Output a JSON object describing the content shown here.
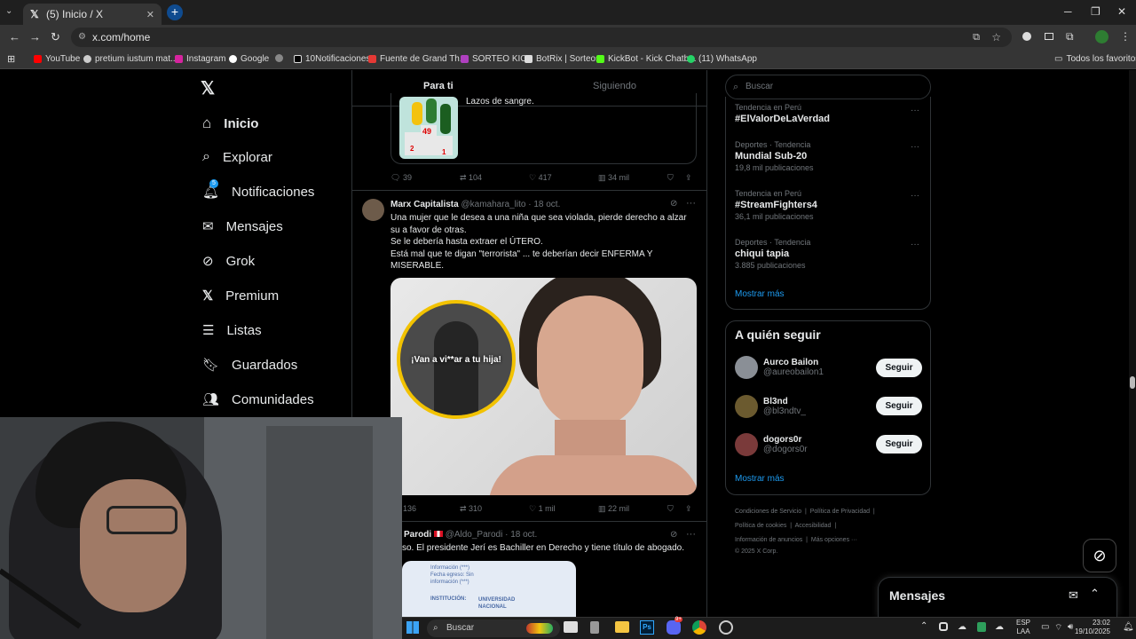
{
  "browser": {
    "tab_title": "(5) Inicio / X",
    "url": "x.com/home",
    "bookmarks": [
      "YouTube",
      "pretium iustum mat...",
      "Instagram",
      "Google",
      "10Notificaciones",
      "Fuente de Grand Th...",
      "SORTEO KICK",
      "BotRix | Sorteos",
      "KickBot - Kick Chatb...",
      "(11) WhatsApp"
    ],
    "bookmarks_right": "Todos los favoritos"
  },
  "nav": {
    "items": [
      "Inicio",
      "Explorar",
      "Notificaciones",
      "Mensajes",
      "Grok",
      "Premium",
      "Listas",
      "Guardados",
      "Comunidades"
    ],
    "notif_badge": "5"
  },
  "feed": {
    "tabs": [
      "Para ti",
      "Siguiendo"
    ],
    "prev_tweet": {
      "text": "Lazos de sangre.",
      "img_nums": [
        "49",
        "2",
        "1"
      ],
      "replies": "39",
      "retweets": "104",
      "likes": "417",
      "views": "34 mil"
    },
    "tweet1": {
      "name": "Marx Capitalista",
      "handle": "@kamahara_lito",
      "date": "· 18 oct.",
      "lines": [
        "Una mujer que le desea a una niña que sea violada, pierde derecho a alzar",
        "su a favor de otras.",
        "Se le debería hasta extraer el ÚTERO.",
        "Está mal que te digan \"terrorista\" ... te deberían decir ENFERMA Y",
        "MISERABLE."
      ],
      "overlay_text": "¡Van a vi**ar a tu hija!",
      "replies": "136",
      "retweets": "310",
      "likes": "1 mil",
      "views": "22 mil"
    },
    "tweet2": {
      "name": "do Parodi",
      "handle": "@Aldo_Parodi",
      "date": "· 18 oct.",
      "text": "so. El presidente Jerí es Bachiller en Derecho y tiene título de abogado.",
      "doc_lines": [
        "Información (***)",
        "Fecha egreso: Sin",
        "información (***)"
      ],
      "doc_label": "INSTITUCIÓN:",
      "doc_value": "UNIVERSIDAD NACIONAL"
    }
  },
  "sidebar": {
    "search_placeholder": "Buscar",
    "trends": [
      {
        "cat": "Tendencia en Perú",
        "name": "#ElValorDeLaVerdad",
        "count": ""
      },
      {
        "cat": "Deportes · Tendencia",
        "name": "Mundial Sub-20",
        "count": "19,8 mil publicaciones"
      },
      {
        "cat": "Tendencia en Perú",
        "name": "#StreamFighters4",
        "count": "36,1 mil publicaciones"
      },
      {
        "cat": "Deportes · Tendencia",
        "name": "chiqui tapia",
        "count": "3.885 publicaciones"
      }
    ],
    "show_more": "Mostrar más",
    "who_to_follow": "A quién seguir",
    "follows": [
      {
        "name": "Aurco Bailon",
        "handle": "@aureobailon1"
      },
      {
        "name": "Bl3nd",
        "handle": "@bl3ndtv_"
      },
      {
        "name": "dogors0r",
        "handle": "@dogors0r"
      }
    ],
    "follow_label": "Seguir",
    "show_more_2": "Mostrar más",
    "footer_row1": [
      "Condiciones de Servicio",
      "Política de Privacidad"
    ],
    "footer_row2": [
      "Política de cookies",
      "Accesibilidad"
    ],
    "footer_row3": [
      "Información de anuncios",
      "Más opciones ···"
    ],
    "copyright": "© 2025 X Corp.",
    "messages": "Mensajes"
  },
  "taskbar": {
    "search": "Buscar",
    "lang1": "ESP",
    "lang2": "LAA",
    "time": "23:02",
    "date": "19/10/2025",
    "discord_badge": "9+"
  },
  "colors": {
    "accent": "#1d9bf0",
    "bg": "#000000",
    "muted": "#71767b",
    "chrome": "#353535"
  }
}
